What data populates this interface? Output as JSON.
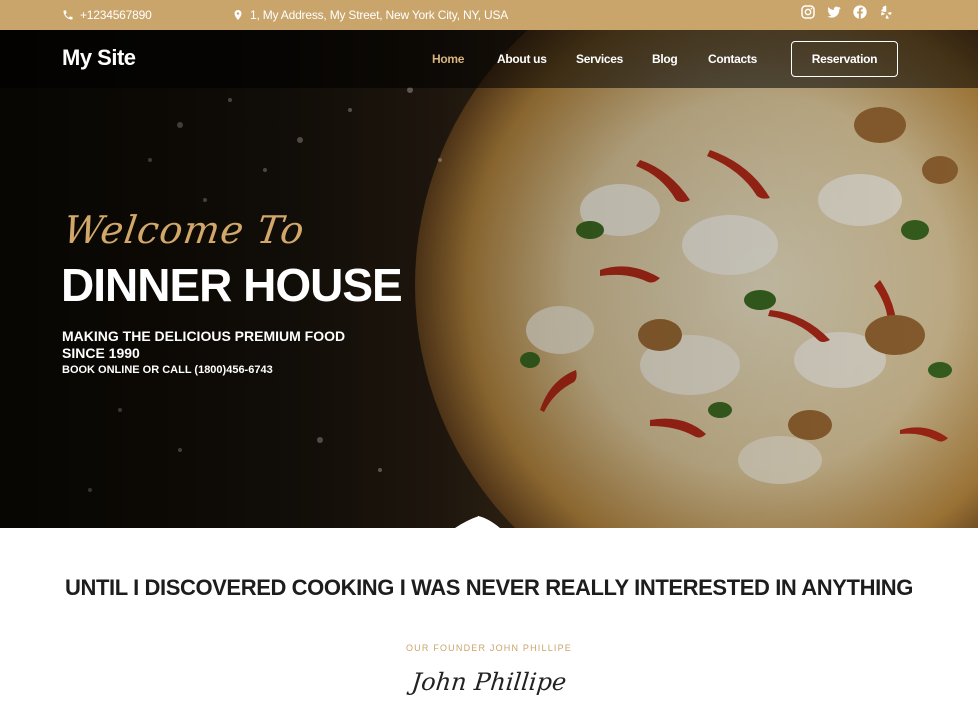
{
  "topbar": {
    "phone": "+1234567890",
    "address": "1, My Address, My Street, New York City, NY, USA",
    "social_icons": [
      "instagram-icon",
      "twitter-icon",
      "facebook-icon",
      "yelp-icon"
    ],
    "background": "#c9a56c"
  },
  "header": {
    "logo": "My Site",
    "nav": [
      {
        "label": "Home",
        "active": true
      },
      {
        "label": "About us"
      },
      {
        "label": "Services"
      },
      {
        "label": "Blog"
      },
      {
        "label": "Contacts"
      }
    ],
    "reservation_label": "Reservation"
  },
  "hero": {
    "script_text": "Welcome To",
    "title": "DINNER HOUSE",
    "subtitle": "MAKING THE DELICIOUS PREMIUM FOOD SINCE 1990",
    "cta_text": "BOOK ONLINE OR CALL (1800)456-6743"
  },
  "about": {
    "quote": "UNTIL I DISCOVERED COOKING I WAS NEVER REALLY INTERESTED IN ANYTHING",
    "founder": "OUR FOUNDER JOHN PHILLIPE",
    "signature": "John Phillipe"
  },
  "colors": {
    "accent": "#c9a56c",
    "nav_active": "#d7b57c",
    "text_dark": "#1d1d1d"
  }
}
